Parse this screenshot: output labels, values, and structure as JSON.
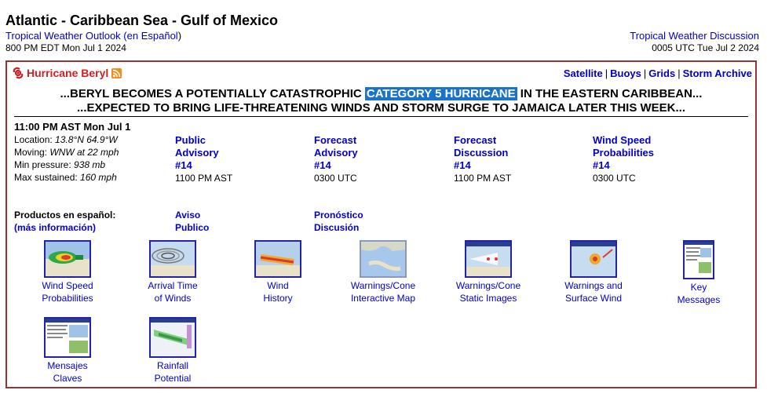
{
  "header": {
    "title": "Atlantic - Caribbean Sea - Gulf of Mexico",
    "outlook_link": "Tropical Weather Outlook",
    "outlook_paren_open": " (",
    "outlook_es_link": "en Español",
    "outlook_paren_close": ")",
    "outlook_time": "800 PM EDT Mon Jul 1 2024",
    "discussion_link": "Tropical Weather Discussion",
    "discussion_time": "0005 UTC Tue Jul 2 2024"
  },
  "storm": {
    "name": "Hurricane Beryl",
    "links": [
      "Satellite",
      "Buoys",
      "Grids",
      "Storm Archive"
    ],
    "headline1_pre": "...BERYL BECOMES A POTENTIALLY CATASTROPHIC ",
    "headline1_hl": "CATEGORY 5 HURRICANE",
    "headline1_post": " IN THE EASTERN CARIBBEAN...",
    "headline2": "...EXPECTED TO BRING LIFE-THREATENING WINDS AND STORM SURGE TO JAMAICA LATER THIS WEEK...",
    "status": {
      "time": "11:00 PM AST Mon Jul 1",
      "location_label": "Location: ",
      "location_value": "13.8°N 64.9°W",
      "moving_label": "Moving: ",
      "moving_value": "WNW at 22 mph",
      "pressure_label": "Min pressure: ",
      "pressure_value": "938 mb",
      "sustained_label": "Max sustained: ",
      "sustained_value": "160 mph"
    },
    "products": [
      {
        "l1": "Public",
        "l2": "Advisory",
        "l3": "#14",
        "time": "1100 PM AST"
      },
      {
        "l1": "Forecast",
        "l2": "Advisory",
        "l3": "#14",
        "time": "0300 UTC"
      },
      {
        "l1": "Forecast",
        "l2": "Discussion",
        "l3": "#14",
        "time": "1100 PM AST"
      },
      {
        "l1": "Wind Speed",
        "l2": "Probabilities",
        "l3": "#14",
        "time": "0300 UTC"
      }
    ],
    "espanol": {
      "label": "Productos en español:",
      "more": "(más información)",
      "aviso_l1": "Aviso",
      "aviso_l2": "Publico",
      "pron_l1": "Pronóstico",
      "pron_l2": "Discusión"
    },
    "graphics": [
      {
        "l1": "Wind Speed",
        "l2": "Probabilities",
        "icon": "wind-prob-map-icon"
      },
      {
        "l1": "Arrival Time",
        "l2": "of Winds",
        "icon": "arrival-time-map-icon"
      },
      {
        "l1": "Wind",
        "l2": "History",
        "icon": "wind-history-map-icon"
      },
      {
        "l1": "Warnings/Cone",
        "l2": "Interactive Map",
        "icon": "interactive-map-icon"
      },
      {
        "l1": "Warnings/Cone",
        "l2": "Static Images",
        "icon": "cone-map-icon"
      },
      {
        "l1": "Warnings and",
        "l2": "Surface Wind",
        "icon": "surface-wind-map-icon"
      },
      {
        "l1": "Key",
        "l2": "Messages",
        "icon": "key-messages-icon"
      },
      {
        "l1": "Mensajes",
        "l2": "Claves",
        "icon": "mensajes-claves-icon"
      },
      {
        "l1": "Rainfall",
        "l2": "Potential",
        "icon": "rainfall-map-icon"
      }
    ]
  },
  "colors": {
    "link": "#0000cc",
    "storm_name": "#cc2222",
    "box_border": "#993333",
    "highlight": "#1a73c8"
  }
}
